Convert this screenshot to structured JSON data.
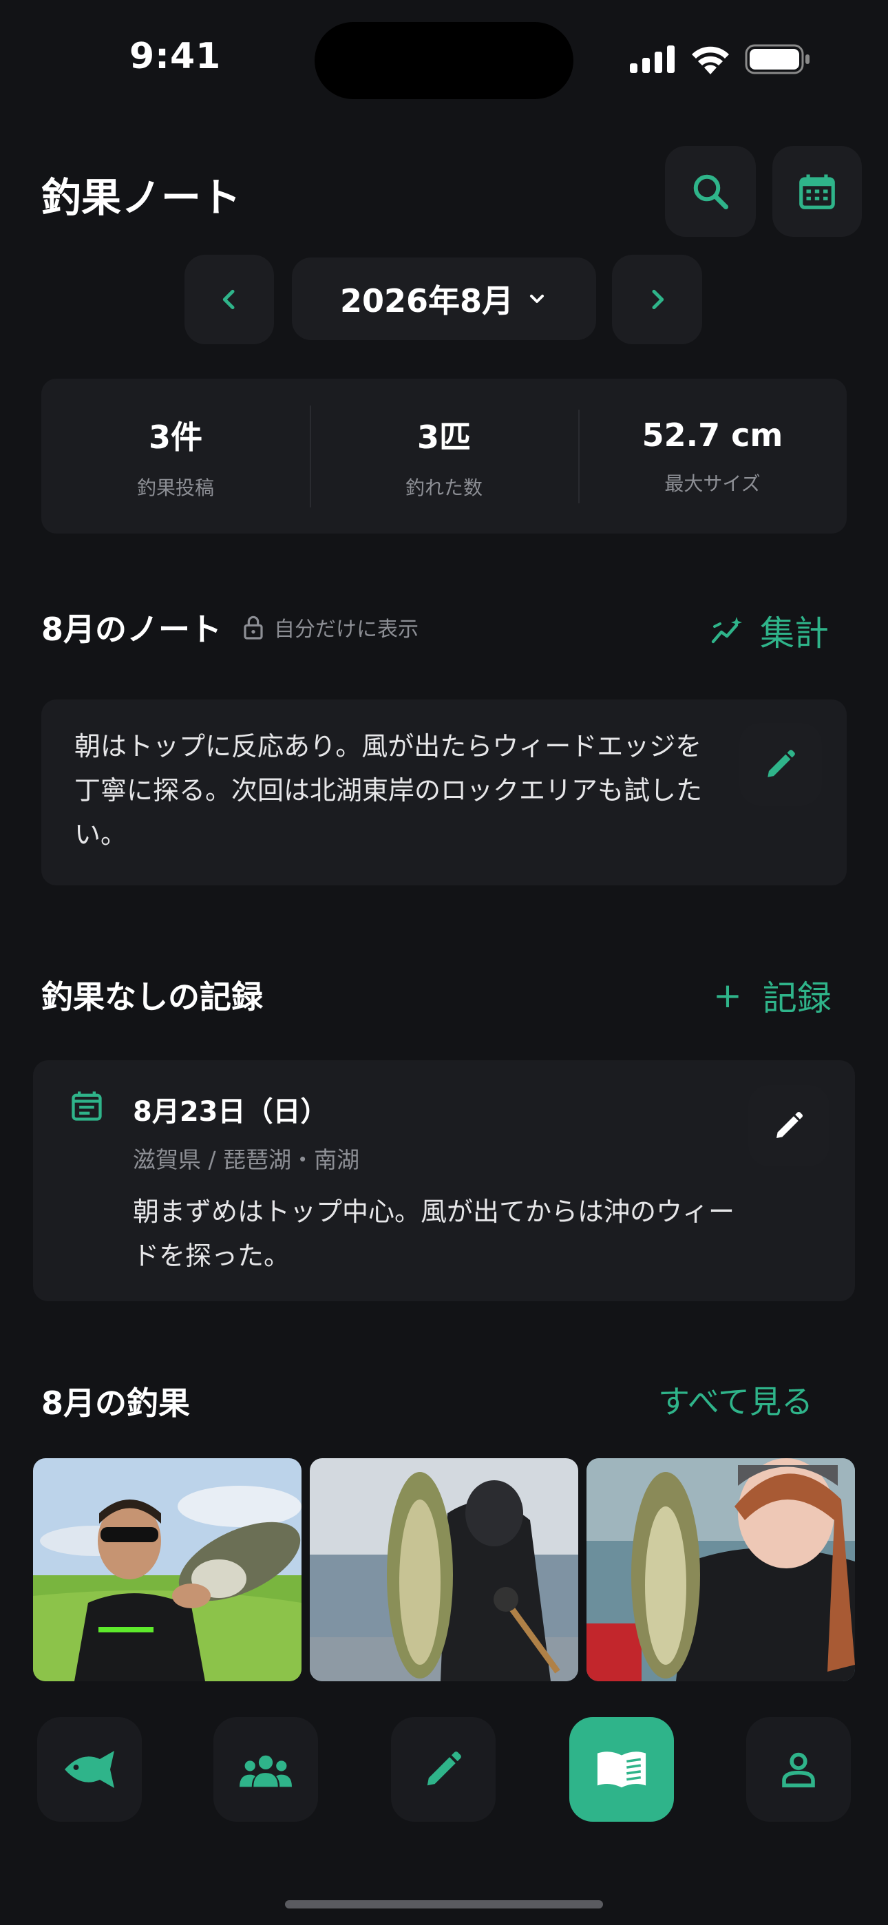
{
  "status": {
    "time": "9:41"
  },
  "header": {
    "title": "釣果ノート"
  },
  "month_nav": {
    "label": "2026年8月"
  },
  "stats": [
    {
      "value": "3件",
      "label": "釣果投稿"
    },
    {
      "value": "3匹",
      "label": "釣れた数"
    },
    {
      "value": "52.7 cm",
      "label": "最大サイズ"
    }
  ],
  "note": {
    "title": "8月のノート",
    "privacy": "自分だけに表示",
    "aggregate_label": "集計",
    "text": "朝はトップに反応あり。風が出たらウィードエッジを丁寧に探る。次回は北湖東岸のロックエリアも試したい。"
  },
  "no_catch": {
    "title": "釣果なしの記録",
    "add_label": "記録",
    "entry": {
      "date": "8月23日（日）",
      "location": "滋賀県 / 琵琶湖・南湖",
      "text": "朝まずめはトップ中心。風が出てからは沖のウィードを探った。"
    }
  },
  "catches": {
    "title": "8月の釣果",
    "see_all": "すべて見る",
    "photos": [
      "man-with-bass-grass",
      "angler-holding-bass-boat",
      "woman-with-bass"
    ]
  },
  "colors": {
    "accent": "#2fb48a",
    "background": "#121316",
    "card": "#1b1c20"
  },
  "bottom_nav": [
    "fish-icon",
    "group-icon",
    "pencil-icon",
    "book-icon",
    "person-icon"
  ]
}
